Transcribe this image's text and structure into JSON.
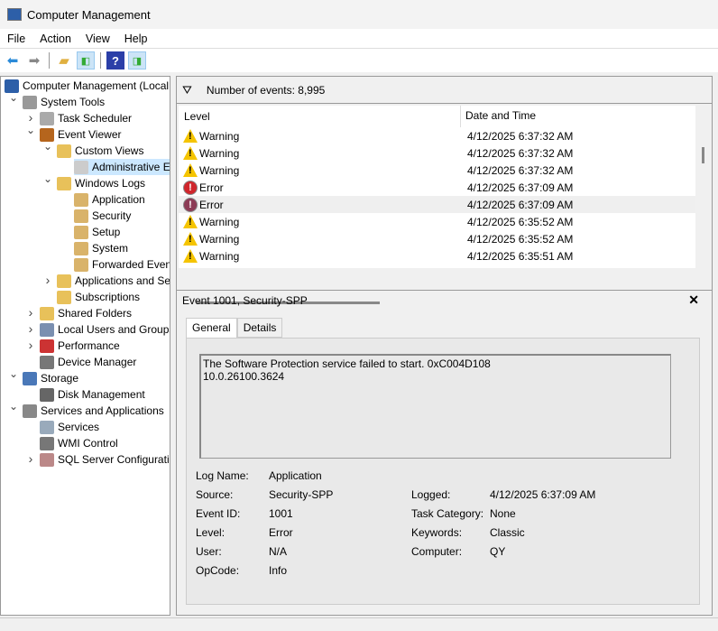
{
  "window": {
    "title": "Computer Management"
  },
  "menu": [
    "File",
    "Action",
    "View",
    "Help"
  ],
  "tree": [
    {
      "label": "Computer Management (Local",
      "level": 0,
      "exp": "",
      "icon": "computer-icon",
      "color": "#2d5fa8"
    },
    {
      "label": "System Tools",
      "level": 1,
      "exp": "v",
      "icon": "tools-icon",
      "color": "#999"
    },
    {
      "label": "Task Scheduler",
      "level": 2,
      "exp": ">",
      "icon": "clock-icon",
      "color": "#aaa"
    },
    {
      "label": "Event Viewer",
      "level": 2,
      "exp": "v",
      "icon": "event-viewer-icon",
      "color": "#b5651d"
    },
    {
      "label": "Custom Views",
      "level": 3,
      "exp": "v",
      "icon": "folder-icon",
      "color": "#e8c15a"
    },
    {
      "label": "Administrative E",
      "level": 4,
      "exp": "",
      "icon": "filter-icon",
      "color": "#ccc",
      "selected": true
    },
    {
      "label": "Windows Logs",
      "level": 3,
      "exp": "v",
      "icon": "folder-icon",
      "color": "#e8c15a"
    },
    {
      "label": "Application",
      "level": 4,
      "exp": "",
      "icon": "log-icon",
      "color": "#d9b36a"
    },
    {
      "label": "Security",
      "level": 4,
      "exp": "",
      "icon": "log-icon",
      "color": "#d9b36a"
    },
    {
      "label": "Setup",
      "level": 4,
      "exp": "",
      "icon": "log-icon",
      "color": "#d9b36a"
    },
    {
      "label": "System",
      "level": 4,
      "exp": "",
      "icon": "log-icon",
      "color": "#d9b36a"
    },
    {
      "label": "Forwarded Event",
      "level": 4,
      "exp": "",
      "icon": "log-icon",
      "color": "#d9b36a"
    },
    {
      "label": "Applications and Se",
      "level": 3,
      "exp": ">",
      "icon": "folder-icon",
      "color": "#e8c15a"
    },
    {
      "label": "Subscriptions",
      "level": 3,
      "exp": "",
      "icon": "subscriptions-icon",
      "color": "#e8c15a"
    },
    {
      "label": "Shared Folders",
      "level": 2,
      "exp": ">",
      "icon": "shared-folder-icon",
      "color": "#e8c15a"
    },
    {
      "label": "Local Users and Groups",
      "level": 2,
      "exp": ">",
      "icon": "users-icon",
      "color": "#7a8fb0"
    },
    {
      "label": "Performance",
      "level": 2,
      "exp": ">",
      "icon": "performance-icon",
      "color": "#c33"
    },
    {
      "label": "Device Manager",
      "level": 2,
      "exp": "",
      "icon": "device-manager-icon",
      "color": "#777"
    },
    {
      "label": "Storage",
      "level": 1,
      "exp": "v",
      "icon": "storage-icon",
      "color": "#4a78b8"
    },
    {
      "label": "Disk Management",
      "level": 2,
      "exp": "",
      "icon": "disk-icon",
      "color": "#666"
    },
    {
      "label": "Services and Applications",
      "level": 1,
      "exp": "v",
      "icon": "services-apps-icon",
      "color": "#888"
    },
    {
      "label": "Services",
      "level": 2,
      "exp": "",
      "icon": "gear-icon",
      "color": "#9ab"
    },
    {
      "label": "WMI Control",
      "level": 2,
      "exp": "",
      "icon": "wmi-icon",
      "color": "#777"
    },
    {
      "label": "SQL Server Configuratic",
      "level": 2,
      "exp": ">",
      "icon": "sql-icon",
      "color": "#b88"
    }
  ],
  "events": {
    "count_label": "Number of events: 8,995",
    "columns": [
      "Level",
      "Date and Time"
    ],
    "rows": [
      {
        "level": "Warning",
        "time": "4/12/2025 6:37:32 AM"
      },
      {
        "level": "Warning",
        "time": "4/12/2025 6:37:32 AM"
      },
      {
        "level": "Warning",
        "time": "4/12/2025 6:37:32 AM"
      },
      {
        "level": "Error",
        "time": "4/12/2025 6:37:09 AM"
      },
      {
        "level": "Error",
        "time": "4/12/2025 6:37:09 AM",
        "selected": true
      },
      {
        "level": "Warning",
        "time": "4/12/2025 6:35:52 AM"
      },
      {
        "level": "Warning",
        "time": "4/12/2025 6:35:52 AM"
      },
      {
        "level": "Warning",
        "time": "4/12/2025 6:35:51 AM"
      }
    ]
  },
  "detail": {
    "title": "Event 1001, Security-SPP",
    "tabs": [
      "General",
      "Details"
    ],
    "message_line1": "The Software Protection service failed to start. 0xC004D108",
    "message_line2": "10.0.26100.3624",
    "fields": {
      "log_name_label": "Log Name:",
      "log_name": "Application",
      "source_label": "Source:",
      "source": "Security-SPP",
      "event_id_label": "Event ID:",
      "event_id": "1001",
      "level_label": "Level:",
      "level": "Error",
      "user_label": "User:",
      "user": "N/A",
      "opcode_label": "OpCode:",
      "opcode": "Info",
      "logged_label": "Logged:",
      "logged": "4/12/2025 6:37:09 AM",
      "task_category_label": "Task Category:",
      "task_category": "None",
      "keywords_label": "Keywords:",
      "keywords": "Classic",
      "computer_label": "Computer:",
      "computer": "QY"
    }
  }
}
